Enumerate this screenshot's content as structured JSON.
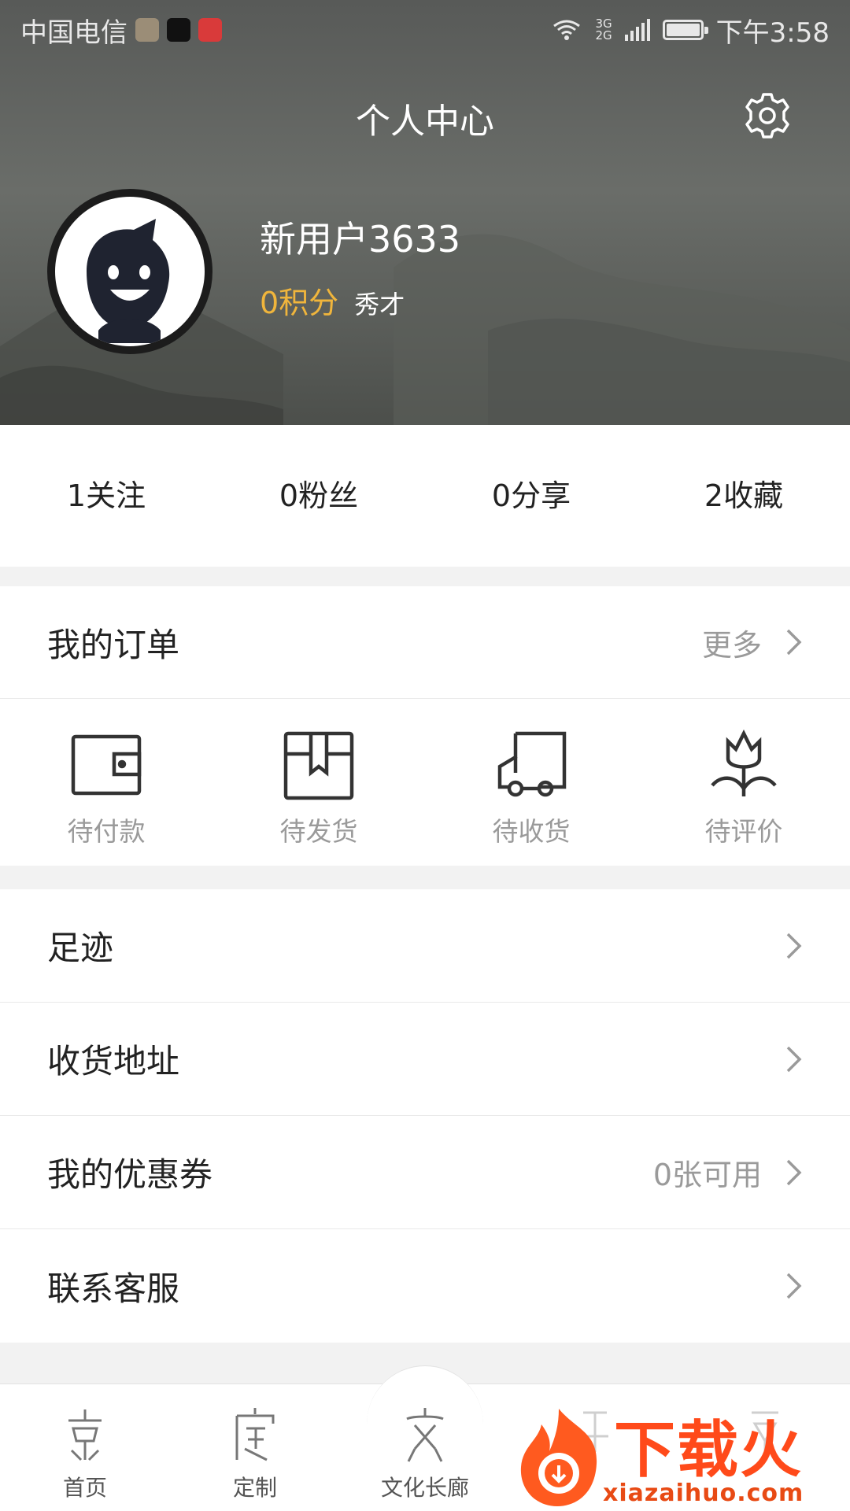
{
  "status_bar": {
    "carrier": "中国电信",
    "network": [
      "3G",
      "2G"
    ],
    "time": "下午3:58",
    "app_icons": [
      "gallery-app-icon",
      "douyin-app-icon",
      "toutiao-app-icon"
    ]
  },
  "header": {
    "title": "个人中心",
    "settings_icon": "gear-icon"
  },
  "profile": {
    "username": "新用户3633",
    "points": "0积分",
    "rank": "秀才",
    "avatar_icon": "smiley-avatar"
  },
  "stats": [
    {
      "label": "1关注"
    },
    {
      "label": "0粉丝"
    },
    {
      "label": "0分享"
    },
    {
      "label": "2收藏"
    }
  ],
  "orders": {
    "title": "我的订单",
    "more": "更多",
    "items": [
      {
        "label": "待付款",
        "icon": "wallet-icon"
      },
      {
        "label": "待发货",
        "icon": "box-icon"
      },
      {
        "label": "待收货",
        "icon": "truck-icon"
      },
      {
        "label": "待评价",
        "icon": "flower-icon"
      }
    ]
  },
  "menu": [
    {
      "title": "足迹",
      "value": ""
    },
    {
      "title": "收货地址",
      "value": ""
    },
    {
      "title": "我的优惠券",
      "value": "0张可用"
    },
    {
      "title": "联系客服",
      "value": ""
    }
  ],
  "tabbar": [
    {
      "label": "首页",
      "icon": "home-seal-icon"
    },
    {
      "label": "定制",
      "icon": "custom-seal-icon"
    },
    {
      "label": "文化长廊",
      "icon": "culture-seal-icon"
    },
    {
      "label": "",
      "icon": "tab4-seal-icon"
    },
    {
      "label": "",
      "icon": "tab5-seal-icon"
    }
  ],
  "watermark": {
    "brand": "下载火",
    "url": "xiazaihuo.com"
  },
  "colors": {
    "accent_points": "#f0b53c",
    "watermark": "#ff4a1a"
  }
}
